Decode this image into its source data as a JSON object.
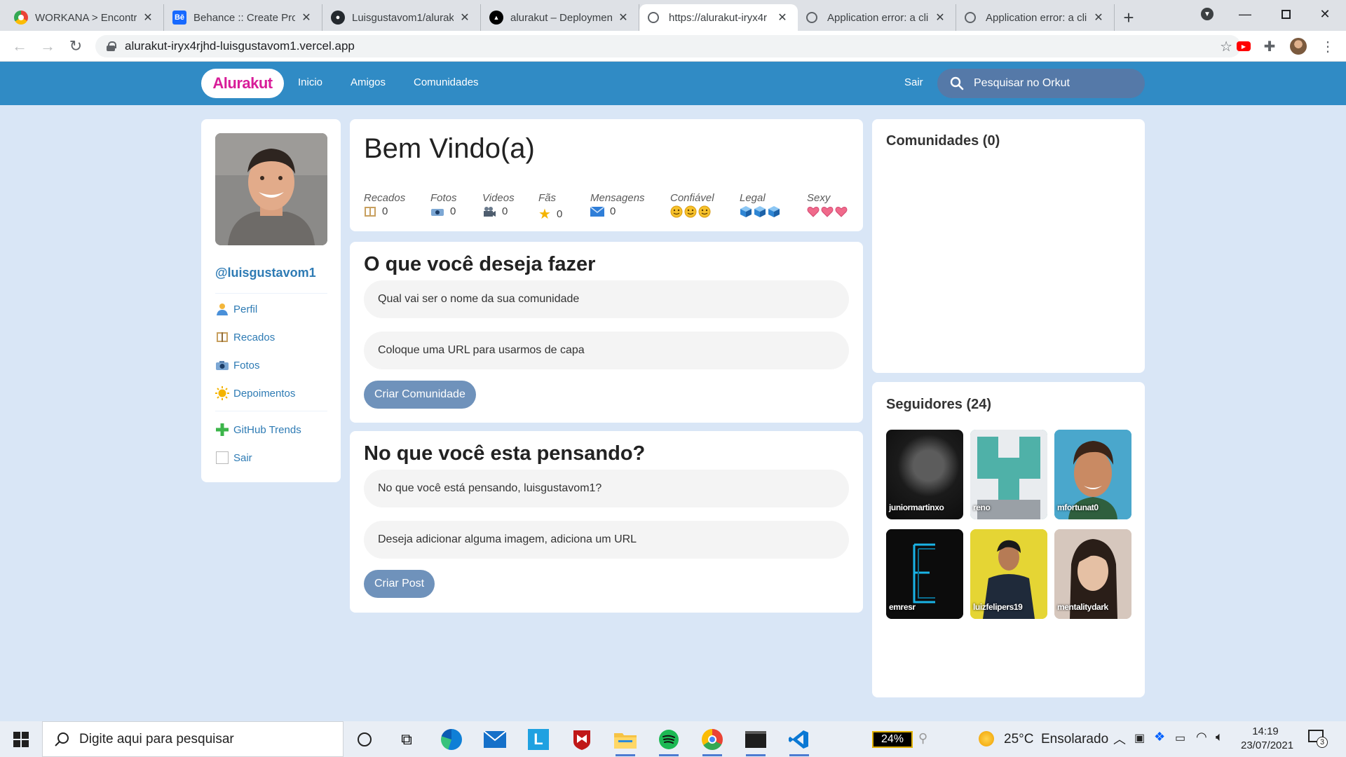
{
  "browser": {
    "tabs": [
      {
        "title": "WORKANA > Encontr",
        "favicon": "workana-icon",
        "active": false
      },
      {
        "title": "Behance :: Create Proj",
        "favicon": "behance-icon",
        "active": false
      },
      {
        "title": "Luisgustavom1/alurak",
        "favicon": "github-icon",
        "active": false
      },
      {
        "title": "alurakut – Deploymen",
        "favicon": "vercel-icon",
        "active": false
      },
      {
        "title": "https://alurakut-iryx4r",
        "favicon": "globe-icon",
        "active": true
      },
      {
        "title": "Application error: a cli",
        "favicon": "globe-icon",
        "active": false
      },
      {
        "title": "Application error: a cli",
        "favicon": "globe-icon",
        "active": false
      }
    ],
    "url": "alurakut-iryx4rjhd-luisgustavom1.vercel.app"
  },
  "site": {
    "logo": "Alurakut",
    "nav": {
      "inicio": "Inicio",
      "amigos": "Amigos",
      "comunidades": "Comunidades"
    },
    "logout": "Sair",
    "search_placeholder": "Pesquisar no Orkut"
  },
  "profile": {
    "username": "@luisgustavom1",
    "menu": {
      "perfil": "Perfil",
      "recados": "Recados",
      "fotos": "Fotos",
      "depoimentos": "Depoimentos",
      "github_trends": "GitHub Trends",
      "sair": "Sair"
    }
  },
  "welcome": {
    "title": "Bem Vindo(a)",
    "stats": {
      "recados": {
        "label": "Recados",
        "value": "0"
      },
      "fotos": {
        "label": "Fotos",
        "value": "0"
      },
      "videos": {
        "label": "Videos",
        "value": "0"
      },
      "fas": {
        "label": "Fãs",
        "value": "0"
      },
      "mensagens": {
        "label": "Mensagens",
        "value": "0"
      },
      "confiavel": {
        "label": "Confiável"
      },
      "legal": {
        "label": "Legal"
      },
      "sexy": {
        "label": "Sexy"
      }
    }
  },
  "community_form": {
    "title": "O que você deseja fazer",
    "name_placeholder": "Qual vai ser o nome da sua comunidade",
    "cover_placeholder": "Coloque uma URL para usarmos de capa",
    "submit": "Criar Comunidade"
  },
  "post_form": {
    "title": "No que você esta pensando?",
    "text_placeholder": "No que você está pensando, luisgustavom1?",
    "image_placeholder": "Deseja adicionar alguma imagem, adiciona um URL",
    "submit": "Criar Post"
  },
  "communities": {
    "title": "Comunidades (0)"
  },
  "followers": {
    "title": "Seguidores (24)",
    "items": [
      "juniormartinxo",
      "reno",
      "mfortunat0",
      "emresr",
      "luizfelipers19",
      "mentalitydark"
    ]
  },
  "taskbar": {
    "search_placeholder": "Digite aqui para pesquisar",
    "battery": "24%",
    "weather": "25°C  Ensolarado",
    "time": "14:19",
    "date": "23/07/2021",
    "notifications": "3"
  },
  "colors": {
    "brand": "#308bc5",
    "logo": "#d81d99",
    "link": "#2e7bb4",
    "page_bg": "#d9e6f6",
    "button": "#6f92bb"
  }
}
